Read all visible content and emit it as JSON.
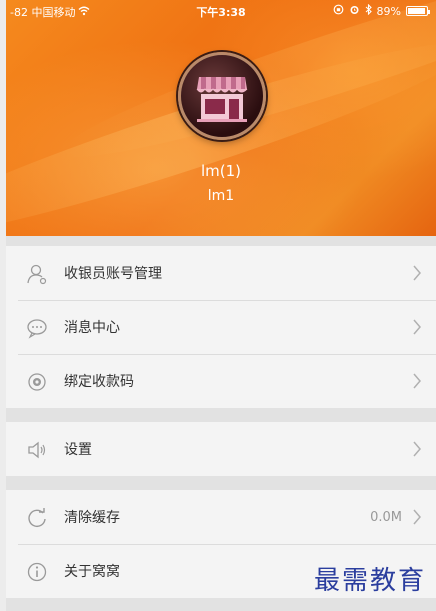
{
  "status_bar": {
    "carrier": "-82 中国移动",
    "time": "下午3:38",
    "battery": "89%"
  },
  "profile": {
    "name": "lm(1)",
    "account": "lm1"
  },
  "menu": {
    "cashier_accounts": "收银员账号管理",
    "message_center": "消息中心",
    "bind_qr": "绑定收款码",
    "settings": "设置",
    "clear_cache": "清除缓存",
    "cache_size": "0.0M",
    "about": "关于窝窝"
  },
  "watermark": "最需教育",
  "colors": {
    "header_orange": "#f07414",
    "list_bg": "#f4f4f4",
    "divider": "#dcdcdc"
  }
}
